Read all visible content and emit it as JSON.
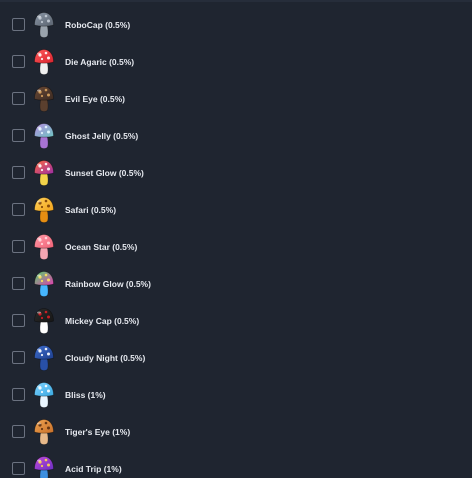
{
  "items": [
    {
      "label": "RoboCap (0.5%)",
      "icon": "robocap-mushroom-icon",
      "cap": "#5b6470",
      "cap2": "#8a96a6",
      "stem": "#9aa3ad",
      "spots": "#c4ccd6"
    },
    {
      "label": "Die Agaric (0.5%)",
      "icon": "die-agaric-mushroom-icon",
      "cap": "#d8242f",
      "cap2": "#ff5a5a",
      "stem": "#f1f1f1",
      "spots": "#ffffff"
    },
    {
      "label": "Evil Eye (0.5%)",
      "icon": "evil-eye-mushroom-icon",
      "cap": "#3b2a22",
      "cap2": "#6b4a36",
      "stem": "#5a3f2e",
      "spots": "#d9a35f"
    },
    {
      "label": "Ghost Jelly (0.5%)",
      "icon": "ghost-jelly-mushroom-icon",
      "cap": "#6fc4c2",
      "cap2": "#b58de0",
      "stem": "#a874d4",
      "spots": "#e6f7ff"
    },
    {
      "label": "Sunset Glow (0.5%)",
      "icon": "sunset-glow-mushroom-icon",
      "cap": "#9b2ea7",
      "cap2": "#ff6a3c",
      "stem": "#f3d34a",
      "spots": "#ffffff"
    },
    {
      "label": "Safari (0.5%)",
      "icon": "safari-mushroom-icon",
      "cap": "#f2a21b",
      "cap2": "#ffd25a",
      "stem": "#e58d12",
      "spots": "#7a3f08"
    },
    {
      "label": "Ocean Star (0.5%)",
      "icon": "ocean-star-mushroom-icon",
      "cap": "#f06277",
      "cap2": "#ff9aa8",
      "stem": "#f4a6b2",
      "spots": "#ffd7de"
    },
    {
      "label": "Rainbow Glow (0.5%)",
      "icon": "rainbow-glow-mushroom-icon",
      "cap": "#e03fb0",
      "cap2": "#55d36b",
      "stem": "#46b6ff",
      "spots": "#ffe45c"
    },
    {
      "label": "Mickey Cap (0.5%)",
      "icon": "mickey-cap-mushroom-icon",
      "cap": "#161616",
      "cap2": "#2b2b2b",
      "stem": "#ffffff",
      "spots": "#d81f26"
    },
    {
      "label": "Cloudy Night (0.5%)",
      "icon": "cloudy-night-mushroom-icon",
      "cap": "#1d3e8c",
      "cap2": "#3f6fd0",
      "stem": "#2850a8",
      "spots": "#ffffff"
    },
    {
      "label": "Bliss (1%)",
      "icon": "bliss-mushroom-icon",
      "cap": "#3aa8e0",
      "cap2": "#7fd3ff",
      "stem": "#e9f6ff",
      "spots": "#ffffff"
    },
    {
      "label": "Tiger's Eye (1%)",
      "icon": "tigers-eye-mushroom-icon",
      "cap": "#c7702a",
      "cap2": "#f0a451",
      "stem": "#e7b98a",
      "spots": "#5a2e10"
    },
    {
      "label": "Acid Trip (1%)",
      "icon": "acid-trip-mushroom-icon",
      "cap": "#6a2fc2",
      "cap2": "#c24bd8",
      "stem": "#3c8fe0",
      "spots": "#ffd84a"
    }
  ]
}
